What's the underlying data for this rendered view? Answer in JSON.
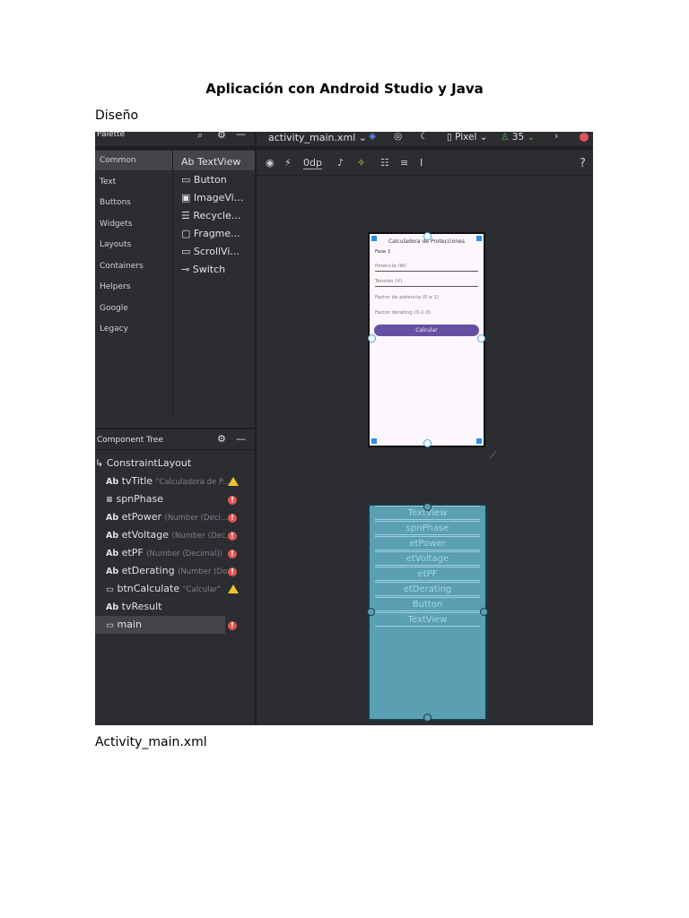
{
  "document": {
    "title": "Aplicación con Android Studio y Java",
    "section_design": "Diseño",
    "section_xml": "Activity_main.xml"
  },
  "ide": {
    "palette": {
      "title": "Palette",
      "categories": [
        "Common",
        "Text",
        "Buttons",
        "Widgets",
        "Layouts",
        "Containers",
        "Helpers",
        "Google",
        "Legacy"
      ],
      "items": [
        {
          "icon": "Ab",
          "label": "TextView"
        },
        {
          "icon": "▭",
          "label": "Button"
        },
        {
          "icon": "▣",
          "label": "ImageVi..."
        },
        {
          "icon": "☰",
          "label": "Recycle..."
        },
        {
          "icon": "▢",
          "label": "Fragme..."
        },
        {
          "icon": "▭",
          "label": "ScrollVi..."
        },
        {
          "icon": "⊸",
          "label": "Switch"
        }
      ]
    },
    "toolbar": {
      "file": "activity_main.xml",
      "device": "Pixel",
      "api": "35",
      "margin": "0dp",
      "help": "?"
    },
    "component_tree": {
      "title": "Component Tree",
      "root": "ConstraintLayout",
      "items": [
        {
          "icon": "Ab",
          "name": "tvTitle",
          "sub": "\"Calculadora de P...",
          "status": "warning"
        },
        {
          "icon": "≡",
          "name": "spnPhase",
          "sub": "",
          "status": "error"
        },
        {
          "icon": "Ab",
          "name": "etPower",
          "sub": "(Number (Deci...",
          "status": "error"
        },
        {
          "icon": "Ab",
          "name": "etVoltage",
          "sub": "(Number (Dec...",
          "status": "error"
        },
        {
          "icon": "Ab",
          "name": "etPF",
          "sub": "(Number (Decimal))",
          "status": "error"
        },
        {
          "icon": "Ab",
          "name": "etDerating",
          "sub": "(Number (Do...",
          "status": "error"
        },
        {
          "icon": "▭",
          "name": "btnCalculate",
          "sub": "\"Calcular\"",
          "status": "warning"
        },
        {
          "icon": "Ab",
          "name": "tvResult",
          "sub": "",
          "status": ""
        },
        {
          "icon": "▭",
          "name": "main",
          "sub": "",
          "status": "error"
        }
      ]
    },
    "preview": {
      "title": "Calculadora de Protecciones",
      "spinner": "Fase 1",
      "power": "Potencia (W)",
      "voltage": "Tensión (V)",
      "pf": "Factor de potencia (0 a 1)",
      "derating": "Factor derating (0-1.0)",
      "button": "Calcular"
    },
    "blueprint": [
      "TextView",
      "spnPhase",
      "etPower",
      "etVoltage",
      "etPF",
      "etDerating",
      "Button",
      "TextView"
    ]
  }
}
